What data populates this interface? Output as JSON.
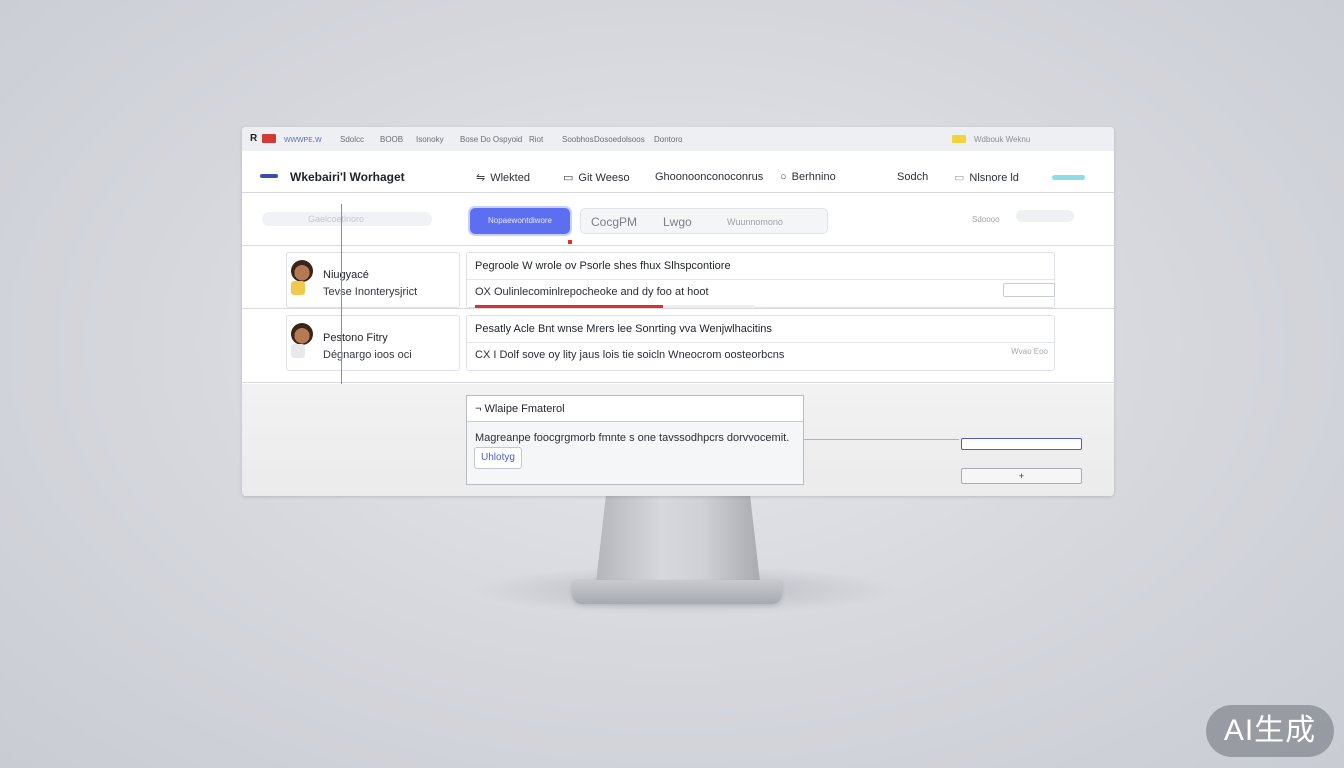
{
  "browser": {
    "logo_letter": "R",
    "url": "ᴡᴡᴡᴘᴇ.ᴡ",
    "bookmarks": [
      "Sdolcc",
      "BOOB",
      "Isonoky",
      "Bose Do Ospyoid",
      "Riot",
      "Soobhos",
      "Dosoedolsoos",
      "Dontoro"
    ],
    "extension_text": "Wdbouk Weknu"
  },
  "header": {
    "app_name": "Wkebairi'l Worhaget",
    "nav": [
      {
        "label": "Wlekted",
        "icon": "sliders-icon"
      },
      {
        "label": "Git Weeso",
        "icon": "folder-icon"
      },
      {
        "label": "Ghoonoonconoconrus",
        "icon": ""
      },
      {
        "label": "Berhnino",
        "icon": "circle-icon"
      },
      {
        "label": "Sodch",
        "icon": ""
      },
      {
        "label": "Nlsnore ld",
        "icon": "image-icon"
      }
    ]
  },
  "toolbar": {
    "search_placeholder": "Gaelcoetlnoro",
    "primary_tab": "Nopaewontdiwore",
    "tabs": [
      "CocgPM",
      "Lwgo",
      "Wuunnomono"
    ],
    "right_label": "Sdoooo"
  },
  "rows": [
    {
      "name": "Niugyacé",
      "subtitle": "Tevse Inonterysjrict",
      "title": "Pegroole W wrole ov Psorle shes fhux Slhspcontiore",
      "body": "OX Oulinlecominlrepocheoke and dy foo at hoot",
      "progress": 0.67,
      "meta": ""
    },
    {
      "name": "Pestono Fitry",
      "subtitle": "Dégnargo ioos oci",
      "title": "Pesatly Acle Bnt wnse Mrers lee Sonrting vva Wenjwlhacitins",
      "body": "CX I Dolf sove oy lity jaus lois tie soicln Wneocrom oosteorbcns",
      "progress": 0,
      "meta": "Wvao Eoo"
    }
  ],
  "dialog": {
    "title": "Wlaipe Fmaterol",
    "title_icon": "dash-icon",
    "body": "Magreanpe foocgrgmorb fmnte s one tavssodhpcrs dorvvocemit.",
    "button": "Uhlotyg"
  },
  "footer": {
    "gray_field_value": "+"
  },
  "watermark": "AI生成",
  "colors": {
    "accent": "#5c6ff0",
    "danger": "#d8322c",
    "brand": "#3c4fa8"
  }
}
